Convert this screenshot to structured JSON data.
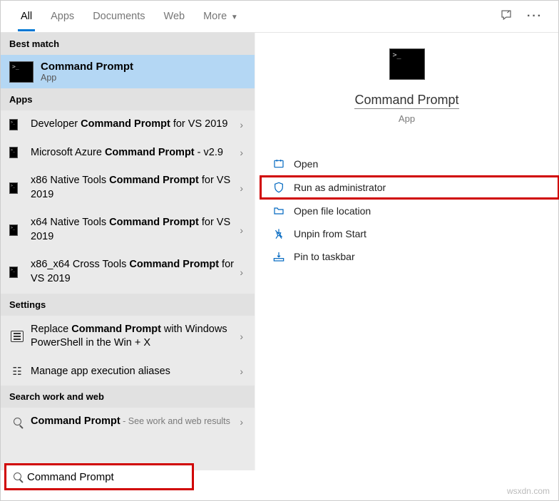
{
  "header": {
    "tabs": [
      {
        "label": "All",
        "active": true
      },
      {
        "label": "Apps"
      },
      {
        "label": "Documents"
      },
      {
        "label": "Web"
      },
      {
        "label": "More",
        "dropdown": true
      }
    ]
  },
  "sections": {
    "best_match": {
      "header": "Best match",
      "title": "Command Prompt",
      "subtitle": "App"
    },
    "apps": {
      "header": "Apps",
      "items": [
        {
          "pre": "Developer ",
          "bold": "Command Prompt",
          "post": " for VS 2019"
        },
        {
          "pre": "Microsoft Azure ",
          "bold": "Command Prompt",
          "post": " - v2.9"
        },
        {
          "pre": "x86 Native Tools ",
          "bold": "Command Prompt",
          "post": " for VS 2019"
        },
        {
          "pre": "x64 Native Tools ",
          "bold": "Command Prompt",
          "post": " for VS 2019"
        },
        {
          "pre": "x86_x64 Cross Tools ",
          "bold": "Command Prompt",
          "post": " for VS 2019"
        }
      ]
    },
    "settings": {
      "header": "Settings",
      "items": [
        {
          "pre": "Replace ",
          "bold": "Command Prompt",
          "post": " with Windows PowerShell in the Win + X"
        },
        {
          "pre": "Manage app execution aliases",
          "bold": "",
          "post": ""
        }
      ]
    },
    "web": {
      "header": "Search work and web",
      "item": {
        "bold": "Command Prompt",
        "hint": " - See work and web results"
      }
    }
  },
  "preview": {
    "title": "Command Prompt",
    "subtitle": "App",
    "actions": [
      {
        "icon": "open",
        "label": "Open"
      },
      {
        "icon": "shield",
        "label": "Run as administrator",
        "highlighted": true
      },
      {
        "icon": "folder",
        "label": "Open file location"
      },
      {
        "icon": "unpin",
        "label": "Unpin from Start"
      },
      {
        "icon": "taskbar",
        "label": "Pin to taskbar"
      }
    ]
  },
  "search": {
    "value": "Command Prompt"
  },
  "watermark": "wsxdn.com"
}
